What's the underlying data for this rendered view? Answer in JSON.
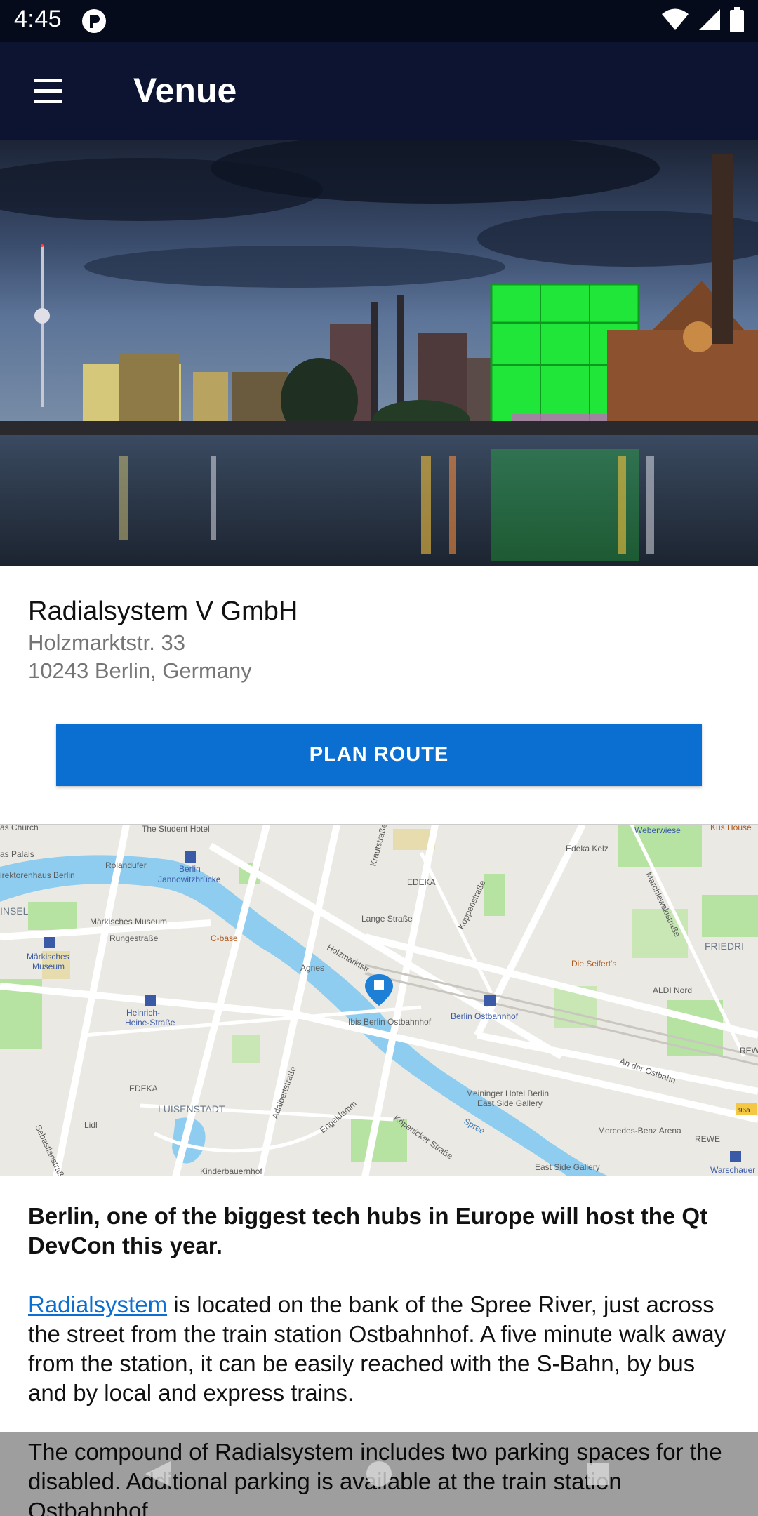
{
  "status_bar": {
    "time": "4:45",
    "icons": [
      "app-notification-icon",
      "wifi-icon",
      "cell-signal-icon",
      "battery-icon"
    ]
  },
  "app_bar": {
    "title": "Venue",
    "menu_icon": "hamburger-menu-icon"
  },
  "hero_image": {
    "alt_subject": "night cityscape",
    "accent_color": "#21e63a"
  },
  "venue": {
    "name": "Radialsystem V GmbH",
    "street": "Holzmarktstr. 33",
    "city": "10243 Berlin, Germany"
  },
  "plan_route_label": "PLAN ROUTE",
  "map_labels": {
    "l1": "The Student Hotel",
    "l2": "Rolandufer",
    "l3": "Berlin",
    "l4": "Jannowitzbrücke",
    "l5": "Märkisches Museum",
    "l6": "Rungestraße",
    "l7": "C-base",
    "l8": "Märkisches",
    "l9": "Museum",
    "l10": "Heinrich-",
    "l11": "Heine-Straße",
    "l12": "EDEKA",
    "l13": "LUISENSTADT",
    "l14": "Lidl",
    "l15": "Adalbertstraße",
    "l16": "Engeldamm",
    "l17": "Köpenicker Straße",
    "l18": "Kinderbauernhof",
    "l19": "Holzmarktstr.",
    "l20": "Agnes",
    "l21": "Lange Straße",
    "l22": "Koppenstraße",
    "l23": "Krautstraße",
    "l24": "Ibis Berlin Ostbahnhof",
    "l25": "Berlin Ostbahnhof",
    "l26": "Meininger Hotel Berlin",
    "l27": "East Side Gallery",
    "l28": "Spree",
    "l29": "East Side Gallery",
    "l30": "Edeka Kelz",
    "l31": "Weberwiese",
    "l32": "Marchlewskistraße",
    "l33": "Die Seifert's",
    "l34": "ALDI Nord",
    "l35": "FRIEDRI",
    "l36": "An der Ostbahn",
    "l37": "Mercedes-Benz Arena",
    "l38": "REWE",
    "l39": "Warschauer",
    "l40": "EDEKA",
    "l41": "INSEL",
    "l42": "irektorenhaus Berlin",
    "l43": "as Palais",
    "l44": "as Church",
    "l45": "Sebastianstraße",
    "l46": "96a",
    "l47": "Kus House",
    "l48": "REW"
  },
  "content": {
    "lead": "Berlin, one of the biggest tech hubs in Europe will host the Qt DevCon this year.",
    "link_text": "Radialsystem",
    "paragraph1_rest": " is located on the bank of the Spree River, just across the street from the train station Ostbahnhof. A five minute walk away from the station, it can be easily reached with the S-Bahn, by bus and by local and express trains.",
    "paragraph2": "The compound of Radialsystem includes two parking spaces for the disabled. Additional parking is available at the train station Ostbahnhof."
  },
  "nav_bar": {
    "icons": [
      "back-icon",
      "home-icon",
      "recents-icon"
    ]
  }
}
